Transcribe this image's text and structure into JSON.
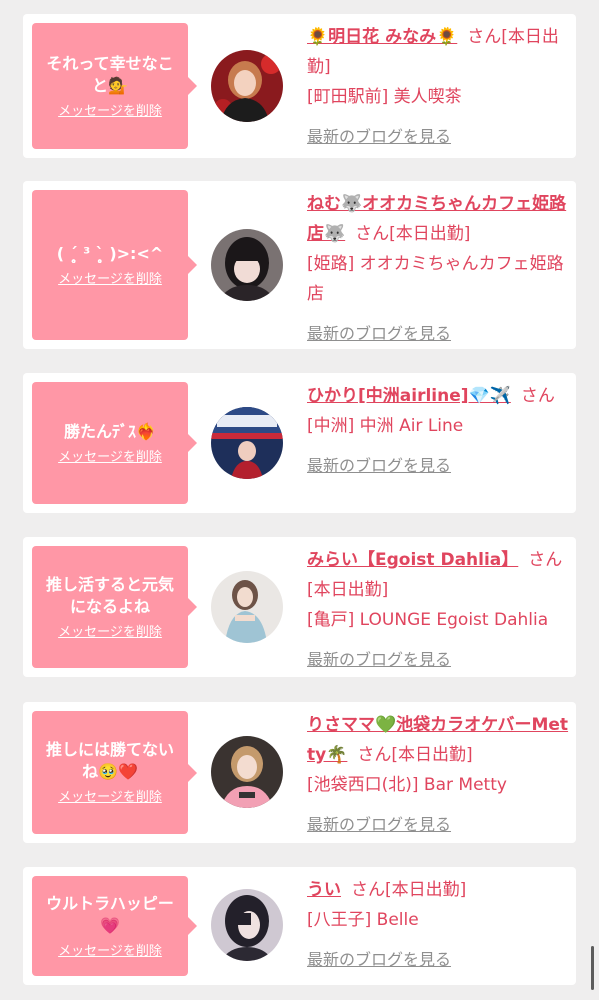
{
  "delete_label": "メッセージを削除",
  "blog_label": "最新のブログを見る",
  "honorific": "さん",
  "items": [
    {
      "message": "それって幸せなこと💁",
      "cast_name": "🌻明日花 みなみ🌻",
      "status": "[本日出勤]",
      "location": "[町田駅前] 美人喫茶"
    },
    {
      "message": "( ˊ̥̥̥̥̥ ³ ˋ̥̥̥̥̥ )>:<^",
      "cast_name": "ねむ🐺オオカミちゃんカフェ姫路店🐺",
      "status": "[本日出勤]",
      "location": "[姫路] オオカミちゃんカフェ姫路店"
    },
    {
      "message": "勝たんﾃﾞｽ❤️‍🔥",
      "cast_name": "ひかり[中洲airline]💎✈️",
      "status": "",
      "location": "[中洲] 中洲 Air Line"
    },
    {
      "message": "推し活すると元気になるよね",
      "cast_name": "みらい【Egoist Dahlia】",
      "status": "[本日出勤]",
      "location": "[亀戸] LOUNGE Egoist Dahlia"
    },
    {
      "message": "推しには勝てないね🥹❤️",
      "cast_name": "りさママ💚池袋カラオケバーMetty🌴",
      "status": "[本日出勤]",
      "location": "[池袋西口(北)] Bar Metty"
    },
    {
      "message": "ウルトラハッピー💗",
      "cast_name": "うい",
      "status": "[本日出勤]",
      "location": "[八王子] Belle"
    }
  ]
}
